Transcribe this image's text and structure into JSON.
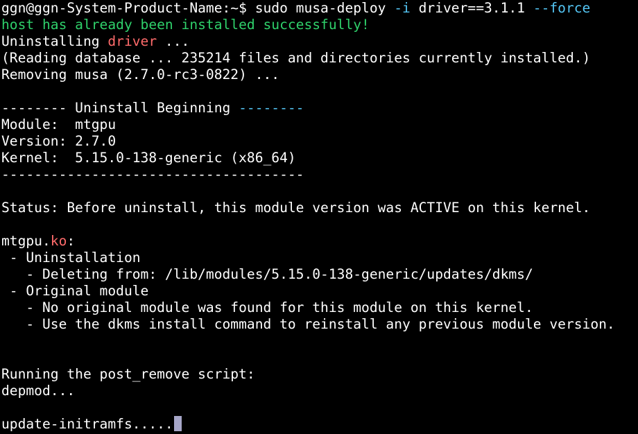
{
  "terminal": {
    "colors": {
      "background": "#000000",
      "text": "#ffffff",
      "success": "#2fd16b",
      "highlight": "#ff6b6b",
      "separator": "#54c6f5",
      "cursor": "#a6a6c8"
    },
    "lines": [
      {
        "segments": [
          {
            "text": "ggn@ggn-System-Product-Name:~$ sudo musa-deploy ",
            "color": ""
          },
          {
            "text": "-i",
            "color": "cyan"
          },
          {
            "text": " driver==3.1.1 ",
            "color": ""
          },
          {
            "text": "--force",
            "color": "cyan"
          }
        ]
      },
      {
        "segments": [
          {
            "text": "host has already been installed successfully!",
            "color": "green"
          }
        ]
      },
      {
        "segments": [
          {
            "text": "Uninstalling ",
            "color": ""
          },
          {
            "text": "driver",
            "color": "red"
          },
          {
            "text": " ...",
            "color": ""
          }
        ]
      },
      {
        "segments": [
          {
            "text": "(Reading database ... 235214 files and directories currently installed.)",
            "color": ""
          }
        ]
      },
      {
        "segments": [
          {
            "text": "Removing musa (2.7.0-rc3-0822) ...",
            "color": ""
          }
        ]
      },
      {
        "segments": [
          {
            "text": "",
            "color": ""
          }
        ]
      },
      {
        "segments": [
          {
            "text": "-------- Uninstall Beginning ",
            "color": ""
          },
          {
            "text": "--------",
            "color": "cyan"
          }
        ]
      },
      {
        "segments": [
          {
            "text": "Module:  mtgpu",
            "color": ""
          }
        ]
      },
      {
        "segments": [
          {
            "text": "Version: 2.7.0",
            "color": ""
          }
        ]
      },
      {
        "segments": [
          {
            "text": "Kernel:  5.15.0-138-generic (x86_64)",
            "color": ""
          }
        ]
      },
      {
        "segments": [
          {
            "text": "-------------------------------------",
            "color": ""
          }
        ]
      },
      {
        "segments": [
          {
            "text": "",
            "color": ""
          }
        ]
      },
      {
        "segments": [
          {
            "text": "Status: Before uninstall, this module version was ACTIVE on this kernel.",
            "color": ""
          }
        ]
      },
      {
        "segments": [
          {
            "text": "",
            "color": ""
          }
        ]
      },
      {
        "segments": [
          {
            "text": "mtgpu.",
            "color": ""
          },
          {
            "text": "ko",
            "color": "red"
          },
          {
            "text": ":",
            "color": ""
          }
        ]
      },
      {
        "segments": [
          {
            "text": " - Uninstallation",
            "color": ""
          }
        ]
      },
      {
        "segments": [
          {
            "text": "   - Deleting from: /lib/modules/5.15.0-138-generic/updates/dkms/",
            "color": ""
          }
        ]
      },
      {
        "segments": [
          {
            "text": " - Original module",
            "color": ""
          }
        ]
      },
      {
        "segments": [
          {
            "text": "   - No original module was found for this module on this kernel.",
            "color": ""
          }
        ]
      },
      {
        "segments": [
          {
            "text": "   - Use the dkms install command to reinstall any previous module version.",
            "color": ""
          }
        ]
      },
      {
        "segments": [
          {
            "text": "",
            "color": ""
          }
        ]
      },
      {
        "segments": [
          {
            "text": "",
            "color": ""
          }
        ]
      },
      {
        "segments": [
          {
            "text": "Running the post_remove script:",
            "color": ""
          }
        ]
      },
      {
        "segments": [
          {
            "text": "depmod...",
            "color": ""
          }
        ]
      },
      {
        "segments": [
          {
            "text": "",
            "color": ""
          }
        ]
      },
      {
        "segments": [
          {
            "text": "update-initramfs.....",
            "color": ""
          }
        ]
      }
    ]
  }
}
